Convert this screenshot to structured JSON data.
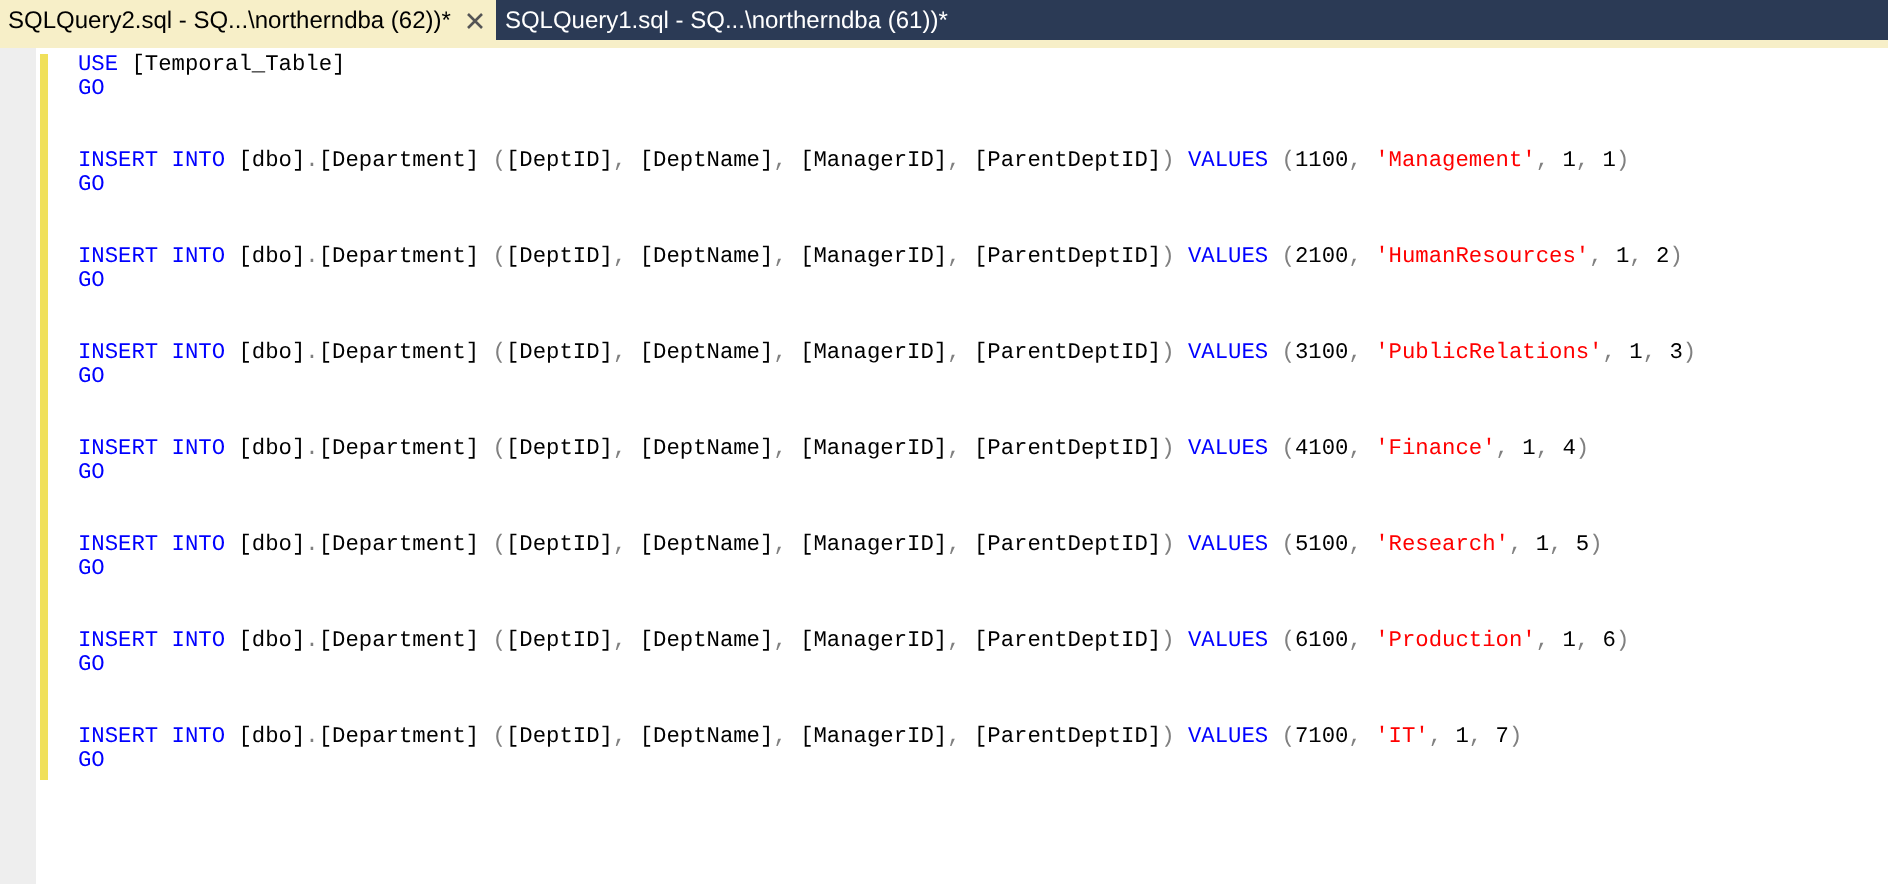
{
  "tabs": [
    {
      "label": "SQLQuery2.sql - SQ...\\northerndba (62))*",
      "selected": true
    },
    {
      "label": "SQLQuery1.sql - SQ...\\northerndba (61))*",
      "selected": false
    }
  ],
  "blocks": [
    {
      "lines": [
        [
          {
            "kind": "keyword",
            "text": "USE"
          },
          {
            "kind": "text",
            "text": " [Temporal_Table]"
          }
        ],
        [
          {
            "kind": "keyword",
            "text": "GO"
          }
        ]
      ]
    },
    {
      "lines": [
        [
          {
            "kind": "keyword",
            "text": "INSERT INTO"
          },
          {
            "kind": "text",
            "text": " [dbo]"
          },
          {
            "kind": "punct",
            "text": "."
          },
          {
            "kind": "text",
            "text": "[Department] "
          },
          {
            "kind": "punct",
            "text": "("
          },
          {
            "kind": "text",
            "text": "[DeptID]"
          },
          {
            "kind": "punct",
            "text": ", "
          },
          {
            "kind": "text",
            "text": "[DeptName]"
          },
          {
            "kind": "punct",
            "text": ", "
          },
          {
            "kind": "text",
            "text": "[ManagerID]"
          },
          {
            "kind": "punct",
            "text": ", "
          },
          {
            "kind": "text",
            "text": "[ParentDeptID]"
          },
          {
            "kind": "punct",
            "text": ") "
          },
          {
            "kind": "keyword",
            "text": "VALUES"
          },
          {
            "kind": "punct",
            "text": " ("
          },
          {
            "kind": "text",
            "text": "1100"
          },
          {
            "kind": "punct",
            "text": ", "
          },
          {
            "kind": "string",
            "text": "'Management'"
          },
          {
            "kind": "punct",
            "text": ", "
          },
          {
            "kind": "text",
            "text": "1"
          },
          {
            "kind": "punct",
            "text": ", "
          },
          {
            "kind": "text",
            "text": "1"
          },
          {
            "kind": "punct",
            "text": ")"
          }
        ],
        [
          {
            "kind": "keyword",
            "text": "GO"
          }
        ]
      ]
    },
    {
      "lines": [
        [
          {
            "kind": "keyword",
            "text": "INSERT INTO"
          },
          {
            "kind": "text",
            "text": " [dbo]"
          },
          {
            "kind": "punct",
            "text": "."
          },
          {
            "kind": "text",
            "text": "[Department] "
          },
          {
            "kind": "punct",
            "text": "("
          },
          {
            "kind": "text",
            "text": "[DeptID]"
          },
          {
            "kind": "punct",
            "text": ", "
          },
          {
            "kind": "text",
            "text": "[DeptName]"
          },
          {
            "kind": "punct",
            "text": ", "
          },
          {
            "kind": "text",
            "text": "[ManagerID]"
          },
          {
            "kind": "punct",
            "text": ", "
          },
          {
            "kind": "text",
            "text": "[ParentDeptID]"
          },
          {
            "kind": "punct",
            "text": ") "
          },
          {
            "kind": "keyword",
            "text": "VALUES"
          },
          {
            "kind": "punct",
            "text": " ("
          },
          {
            "kind": "text",
            "text": "2100"
          },
          {
            "kind": "punct",
            "text": ", "
          },
          {
            "kind": "string",
            "text": "'HumanResources'"
          },
          {
            "kind": "punct",
            "text": ", "
          },
          {
            "kind": "text",
            "text": "1"
          },
          {
            "kind": "punct",
            "text": ", "
          },
          {
            "kind": "text",
            "text": "2"
          },
          {
            "kind": "punct",
            "text": ")"
          }
        ],
        [
          {
            "kind": "keyword",
            "text": "GO"
          }
        ]
      ]
    },
    {
      "lines": [
        [
          {
            "kind": "keyword",
            "text": "INSERT INTO"
          },
          {
            "kind": "text",
            "text": " [dbo]"
          },
          {
            "kind": "punct",
            "text": "."
          },
          {
            "kind": "text",
            "text": "[Department] "
          },
          {
            "kind": "punct",
            "text": "("
          },
          {
            "kind": "text",
            "text": "[DeptID]"
          },
          {
            "kind": "punct",
            "text": ", "
          },
          {
            "kind": "text",
            "text": "[DeptName]"
          },
          {
            "kind": "punct",
            "text": ", "
          },
          {
            "kind": "text",
            "text": "[ManagerID]"
          },
          {
            "kind": "punct",
            "text": ", "
          },
          {
            "kind": "text",
            "text": "[ParentDeptID]"
          },
          {
            "kind": "punct",
            "text": ") "
          },
          {
            "kind": "keyword",
            "text": "VALUES"
          },
          {
            "kind": "punct",
            "text": " ("
          },
          {
            "kind": "text",
            "text": "3100"
          },
          {
            "kind": "punct",
            "text": ", "
          },
          {
            "kind": "string",
            "text": "'PublicRelations'"
          },
          {
            "kind": "punct",
            "text": ", "
          },
          {
            "kind": "text",
            "text": "1"
          },
          {
            "kind": "punct",
            "text": ", "
          },
          {
            "kind": "text",
            "text": "3"
          },
          {
            "kind": "punct",
            "text": ")"
          }
        ],
        [
          {
            "kind": "keyword",
            "text": "GO"
          }
        ]
      ]
    },
    {
      "lines": [
        [
          {
            "kind": "keyword",
            "text": "INSERT INTO"
          },
          {
            "kind": "text",
            "text": " [dbo]"
          },
          {
            "kind": "punct",
            "text": "."
          },
          {
            "kind": "text",
            "text": "[Department] "
          },
          {
            "kind": "punct",
            "text": "("
          },
          {
            "kind": "text",
            "text": "[DeptID]"
          },
          {
            "kind": "punct",
            "text": ", "
          },
          {
            "kind": "text",
            "text": "[DeptName]"
          },
          {
            "kind": "punct",
            "text": ", "
          },
          {
            "kind": "text",
            "text": "[ManagerID]"
          },
          {
            "kind": "punct",
            "text": ", "
          },
          {
            "kind": "text",
            "text": "[ParentDeptID]"
          },
          {
            "kind": "punct",
            "text": ") "
          },
          {
            "kind": "keyword",
            "text": "VALUES"
          },
          {
            "kind": "punct",
            "text": " ("
          },
          {
            "kind": "text",
            "text": "4100"
          },
          {
            "kind": "punct",
            "text": ", "
          },
          {
            "kind": "string",
            "text": "'Finance'"
          },
          {
            "kind": "punct",
            "text": ", "
          },
          {
            "kind": "text",
            "text": "1"
          },
          {
            "kind": "punct",
            "text": ", "
          },
          {
            "kind": "text",
            "text": "4"
          },
          {
            "kind": "punct",
            "text": ")"
          }
        ],
        [
          {
            "kind": "keyword",
            "text": "GO"
          }
        ]
      ]
    },
    {
      "lines": [
        [
          {
            "kind": "keyword",
            "text": "INSERT INTO"
          },
          {
            "kind": "text",
            "text": " [dbo]"
          },
          {
            "kind": "punct",
            "text": "."
          },
          {
            "kind": "text",
            "text": "[Department] "
          },
          {
            "kind": "punct",
            "text": "("
          },
          {
            "kind": "text",
            "text": "[DeptID]"
          },
          {
            "kind": "punct",
            "text": ", "
          },
          {
            "kind": "text",
            "text": "[DeptName]"
          },
          {
            "kind": "punct",
            "text": ", "
          },
          {
            "kind": "text",
            "text": "[ManagerID]"
          },
          {
            "kind": "punct",
            "text": ", "
          },
          {
            "kind": "text",
            "text": "[ParentDeptID]"
          },
          {
            "kind": "punct",
            "text": ") "
          },
          {
            "kind": "keyword",
            "text": "VALUES"
          },
          {
            "kind": "punct",
            "text": " ("
          },
          {
            "kind": "text",
            "text": "5100"
          },
          {
            "kind": "punct",
            "text": ", "
          },
          {
            "kind": "string",
            "text": "'Research'"
          },
          {
            "kind": "punct",
            "text": ", "
          },
          {
            "kind": "text",
            "text": "1"
          },
          {
            "kind": "punct",
            "text": ", "
          },
          {
            "kind": "text",
            "text": "5"
          },
          {
            "kind": "punct",
            "text": ")"
          }
        ],
        [
          {
            "kind": "keyword",
            "text": "GO"
          }
        ]
      ]
    },
    {
      "lines": [
        [
          {
            "kind": "keyword",
            "text": "INSERT INTO"
          },
          {
            "kind": "text",
            "text": " [dbo]"
          },
          {
            "kind": "punct",
            "text": "."
          },
          {
            "kind": "text",
            "text": "[Department] "
          },
          {
            "kind": "punct",
            "text": "("
          },
          {
            "kind": "text",
            "text": "[DeptID]"
          },
          {
            "kind": "punct",
            "text": ", "
          },
          {
            "kind": "text",
            "text": "[DeptName]"
          },
          {
            "kind": "punct",
            "text": ", "
          },
          {
            "kind": "text",
            "text": "[ManagerID]"
          },
          {
            "kind": "punct",
            "text": ", "
          },
          {
            "kind": "text",
            "text": "[ParentDeptID]"
          },
          {
            "kind": "punct",
            "text": ") "
          },
          {
            "kind": "keyword",
            "text": "VALUES"
          },
          {
            "kind": "punct",
            "text": " ("
          },
          {
            "kind": "text",
            "text": "6100"
          },
          {
            "kind": "punct",
            "text": ", "
          },
          {
            "kind": "string",
            "text": "'Production'"
          },
          {
            "kind": "punct",
            "text": ", "
          },
          {
            "kind": "text",
            "text": "1"
          },
          {
            "kind": "punct",
            "text": ", "
          },
          {
            "kind": "text",
            "text": "6"
          },
          {
            "kind": "punct",
            "text": ")"
          }
        ],
        [
          {
            "kind": "keyword",
            "text": "GO"
          }
        ]
      ]
    },
    {
      "lines": [
        [
          {
            "kind": "keyword",
            "text": "INSERT INTO"
          },
          {
            "kind": "text",
            "text": " [dbo]"
          },
          {
            "kind": "punct",
            "text": "."
          },
          {
            "kind": "text",
            "text": "[Department] "
          },
          {
            "kind": "punct",
            "text": "("
          },
          {
            "kind": "text",
            "text": "[DeptID]"
          },
          {
            "kind": "punct",
            "text": ", "
          },
          {
            "kind": "text",
            "text": "[DeptName]"
          },
          {
            "kind": "punct",
            "text": ", "
          },
          {
            "kind": "text",
            "text": "[ManagerID]"
          },
          {
            "kind": "punct",
            "text": ", "
          },
          {
            "kind": "text",
            "text": "[ParentDeptID]"
          },
          {
            "kind": "punct",
            "text": ") "
          },
          {
            "kind": "keyword",
            "text": "VALUES"
          },
          {
            "kind": "punct",
            "text": " ("
          },
          {
            "kind": "text",
            "text": "7100"
          },
          {
            "kind": "punct",
            "text": ", "
          },
          {
            "kind": "string",
            "text": "'IT'"
          },
          {
            "kind": "punct",
            "text": ", "
          },
          {
            "kind": "text",
            "text": "1"
          },
          {
            "kind": "punct",
            "text": ", "
          },
          {
            "kind": "text",
            "text": "7"
          },
          {
            "kind": "punct",
            "text": ")"
          }
        ],
        [
          {
            "kind": "keyword",
            "text": "GO"
          }
        ]
      ]
    }
  ]
}
